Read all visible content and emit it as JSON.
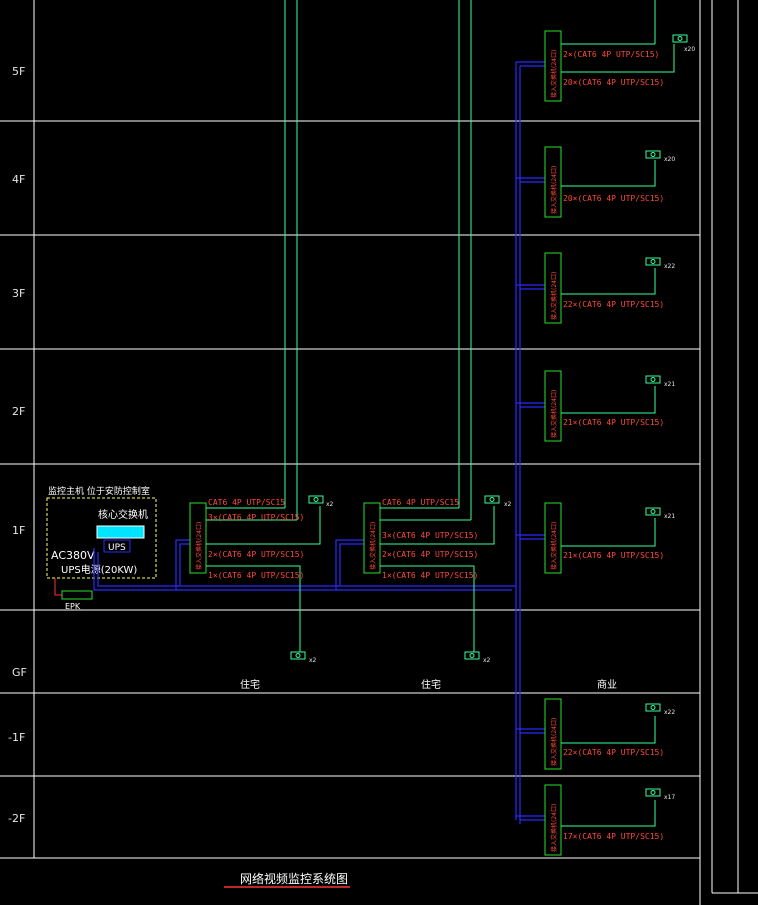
{
  "floors": [
    "5F",
    "4F",
    "3F",
    "2F",
    "1F",
    "GF",
    "-1F",
    "-2F"
  ],
  "title": "网络视频监控系统图",
  "control_room": {
    "title": "监控主机 位于安防控制室",
    "core_switch": "核心交换机",
    "ups": "UPS",
    "power1": "AC380V",
    "power2": "UPS电源(20KW)",
    "epk": "EPK"
  },
  "zones": [
    "住宅",
    "住宅",
    "商业"
  ],
  "switch_label": "接入交换机(24口)",
  "residential_cables": [
    "CAT6 4P UTP/SC15",
    "3×(CAT6 4P UTP/SC15)",
    "2×(CAT6 4P UTP/SC15)",
    "1×(CAT6 4P UTP/SC15)"
  ],
  "cam_counts_res": [
    "x2",
    "x2"
  ],
  "commercial": [
    {
      "floor": "5F",
      "cables": [
        "2×(CAT6 4P UTP/SC15)",
        "20×(CAT6 4P UTP/SC15)"
      ],
      "count": "x20"
    },
    {
      "floor": "4F",
      "cables": [
        "20×(CAT6 4P UTP/SC15)"
      ],
      "count": "x20"
    },
    {
      "floor": "3F",
      "cables": [
        "22×(CAT6 4P UTP/SC15)"
      ],
      "count": "x22"
    },
    {
      "floor": "2F",
      "cables": [
        "21×(CAT6 4P UTP/SC15)"
      ],
      "count": "x21"
    },
    {
      "floor": "1F",
      "cables": [
        "21×(CAT6 4P UTP/SC15)"
      ],
      "count": "x21"
    },
    {
      "floor": "-1F",
      "cables": [
        "22×(CAT6 4P UTP/SC15)"
      ],
      "count": "x22"
    },
    {
      "floor": "-2F",
      "cables": [
        "17×(CAT6 4P UTP/SC15)"
      ],
      "count": "x17"
    }
  ],
  "colors": {
    "grid": "#ffffff",
    "fiber": "#2a2aff",
    "cable": "#39ff9a",
    "switch": "#28e028",
    "text_red": "#ff4a3a",
    "core": "#00e5ff",
    "ctrl_box": "#ffff66"
  }
}
